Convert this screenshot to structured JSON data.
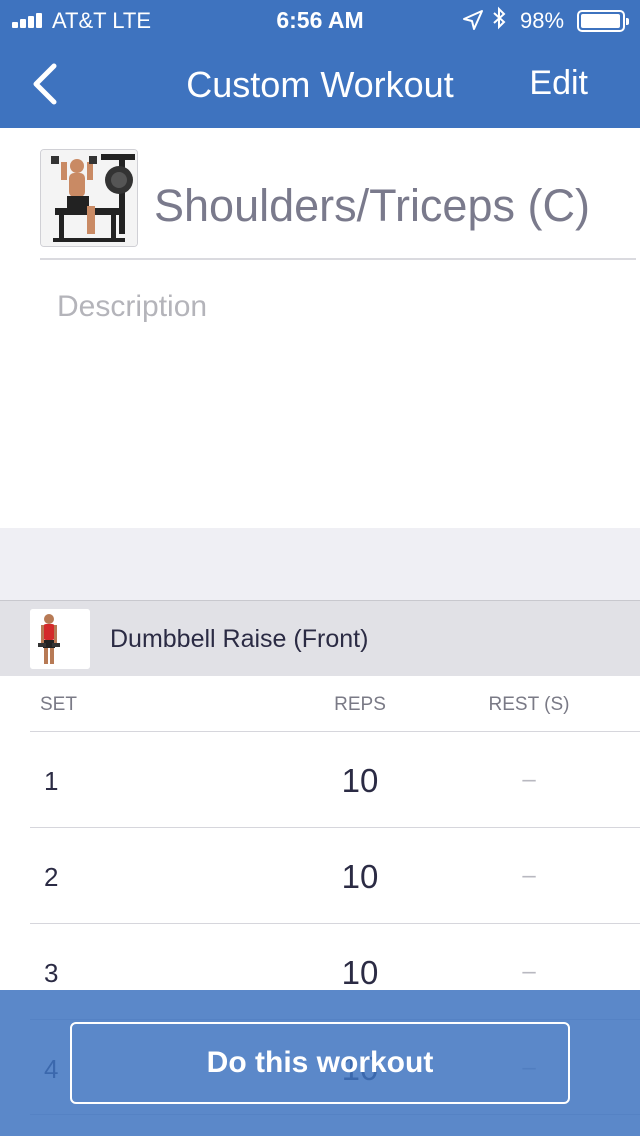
{
  "status_bar": {
    "carrier": "AT&T   LTE",
    "time": "6:56 AM",
    "battery_percent": "98%",
    "battery_level": 0.98,
    "icons": [
      "signal-bars-icon",
      "location-arrow-icon",
      "bluetooth-icon",
      "battery-icon"
    ]
  },
  "nav": {
    "back_icon": "chevron-left-icon",
    "title": "Custom Workout",
    "edit_label": "Edit"
  },
  "workout": {
    "name": "Shoulders/Triceps (C)",
    "description_placeholder": "Description"
  },
  "exercise": {
    "name": "Dumbbell Raise (Front)"
  },
  "table": {
    "headers": {
      "set": "SET",
      "reps": "REPS",
      "rest": "REST (S)"
    },
    "rows": [
      {
        "set": "1",
        "reps": "10",
        "rest": "–"
      },
      {
        "set": "2",
        "reps": "10",
        "rest": "–"
      },
      {
        "set": "3",
        "reps": "10",
        "rest": "–"
      },
      {
        "set": "4",
        "reps": "10",
        "rest": "–"
      }
    ]
  },
  "cta": {
    "label": "Do this workout"
  },
  "colors": {
    "nav_blue": "#3e73bf",
    "text_dark": "#2b2b44",
    "muted": "#7a7a8c"
  }
}
